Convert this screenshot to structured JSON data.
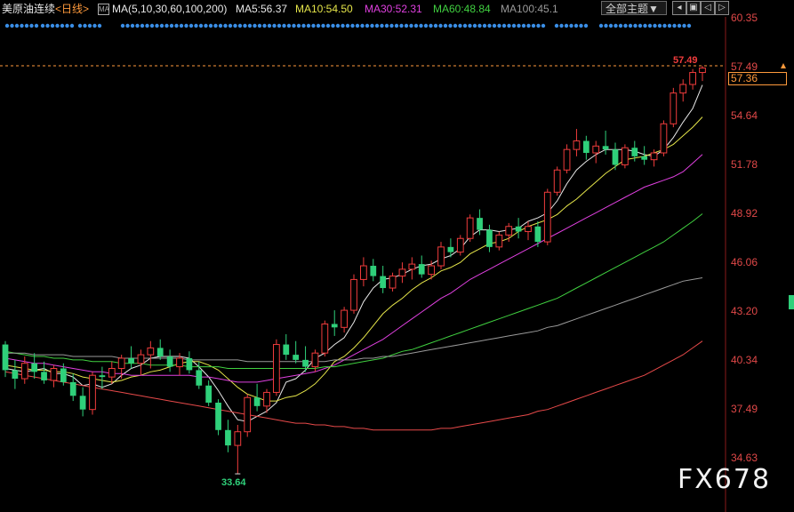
{
  "header": {
    "symbol": "美原油连续",
    "period_open": "<",
    "period": "日线",
    "period_close": ">",
    "ma_icon": "MA",
    "ma_params": "MA(5,10,30,60,100,200)",
    "ma5": "MA5:56.37",
    "ma10": "MA10:54.50",
    "ma30": "MA30:52.31",
    "ma60": "MA60:48.84",
    "ma100": "MA100:45.1",
    "theme_button": "全部主题▼",
    "colors": {
      "ma5": "#e8e8e8",
      "ma10": "#e6e64a",
      "ma30": "#e040e0",
      "ma60": "#40d040",
      "ma100": "#9a9a9a",
      "ma200": "#e84a4a"
    }
  },
  "toolbar_icons": [
    "left-arrow-icon",
    "expand-icon",
    "back-icon",
    "forward-icon"
  ],
  "price_axis": {
    "ticks": [
      "60.35",
      "57.49",
      "54.64",
      "51.78",
      "48.92",
      "46.06",
      "43.20",
      "40.34",
      "37.49",
      "34.63"
    ],
    "current_price": "57.36"
  },
  "annotations": {
    "high": "57.49",
    "low": "33.64"
  },
  "watermark": "FX678",
  "chart_data": {
    "type": "candlestick",
    "ylim": [
      33.0,
      60.35
    ],
    "colors": {
      "up": "#f03c3c",
      "down": "#2fd07a"
    },
    "ohlc": [
      [
        41.2,
        41.4,
        39.3,
        39.7
      ],
      [
        39.7,
        40.3,
        38.6,
        39.2
      ],
      [
        39.2,
        40.5,
        38.9,
        40.1
      ],
      [
        40.1,
        40.7,
        39.2,
        39.6
      ],
      [
        39.6,
        40.2,
        38.9,
        39.1
      ],
      [
        39.1,
        40.0,
        38.7,
        39.8
      ],
      [
        39.8,
        40.1,
        38.8,
        39.0
      ],
      [
        39.0,
        39.5,
        37.9,
        38.2
      ],
      [
        38.2,
        38.7,
        37.0,
        37.4
      ],
      [
        37.4,
        39.6,
        37.1,
        39.4
      ],
      [
        39.4,
        39.9,
        38.6,
        39.3
      ],
      [
        39.3,
        40.2,
        38.9,
        39.8
      ],
      [
        39.8,
        40.6,
        39.2,
        40.4
      ],
      [
        40.4,
        41.1,
        39.8,
        40.1
      ],
      [
        40.1,
        40.9,
        39.4,
        40.6
      ],
      [
        40.6,
        41.4,
        39.8,
        41.0
      ],
      [
        41.0,
        41.5,
        40.3,
        40.5
      ],
      [
        40.5,
        40.9,
        39.6,
        39.9
      ],
      [
        39.9,
        40.7,
        39.4,
        40.4
      ],
      [
        40.4,
        40.8,
        39.5,
        39.7
      ],
      [
        39.7,
        40.2,
        38.6,
        38.8
      ],
      [
        38.8,
        39.1,
        37.6,
        37.8
      ],
      [
        37.8,
        38.0,
        35.9,
        36.2
      ],
      [
        36.2,
        36.8,
        34.9,
        35.3
      ],
      [
        35.3,
        36.5,
        33.64,
        36.1
      ],
      [
        36.1,
        38.3,
        35.8,
        38.1
      ],
      [
        38.1,
        38.9,
        37.3,
        37.6
      ],
      [
        37.6,
        38.6,
        37.2,
        38.4
      ],
      [
        38.4,
        41.5,
        38.2,
        41.2
      ],
      [
        41.2,
        41.8,
        40.3,
        40.6
      ],
      [
        40.6,
        41.4,
        40.1,
        40.3
      ],
      [
        40.3,
        41.1,
        39.6,
        39.9
      ],
      [
        39.9,
        40.9,
        39.6,
        40.7
      ],
      [
        40.7,
        42.6,
        40.5,
        42.4
      ],
      [
        42.4,
        43.2,
        41.7,
        42.2
      ],
      [
        42.2,
        43.4,
        41.9,
        43.2
      ],
      [
        43.2,
        45.3,
        43.0,
        45.0
      ],
      [
        45.0,
        46.3,
        44.6,
        45.8
      ],
      [
        45.8,
        46.2,
        44.9,
        45.2
      ],
      [
        45.2,
        45.8,
        44.2,
        44.5
      ],
      [
        44.5,
        45.4,
        44.3,
        45.2
      ],
      [
        45.2,
        46.0,
        44.8,
        45.6
      ],
      [
        45.6,
        46.3,
        45.0,
        45.9
      ],
      [
        45.9,
        46.4,
        45.1,
        45.3
      ],
      [
        45.3,
        46.1,
        45.0,
        45.8
      ],
      [
        45.8,
        47.2,
        45.6,
        46.9
      ],
      [
        46.9,
        47.4,
        46.3,
        46.6
      ],
      [
        46.6,
        47.6,
        46.4,
        47.4
      ],
      [
        47.4,
        48.8,
        47.2,
        48.6
      ],
      [
        48.6,
        49.1,
        47.6,
        47.9
      ],
      [
        47.9,
        48.2,
        46.6,
        46.9
      ],
      [
        46.9,
        47.8,
        46.7,
        47.6
      ],
      [
        47.6,
        48.3,
        47.2,
        48.1
      ],
      [
        48.1,
        48.6,
        47.4,
        47.8
      ],
      [
        47.8,
        48.4,
        47.3,
        48.1
      ],
      [
        48.1,
        48.4,
        46.9,
        47.2
      ],
      [
        47.2,
        50.3,
        47.0,
        50.1
      ],
      [
        50.1,
        51.6,
        49.9,
        51.4
      ],
      [
        51.4,
        52.9,
        51.2,
        52.6
      ],
      [
        52.6,
        53.8,
        52.2,
        53.1
      ],
      [
        53.1,
        53.4,
        52.0,
        52.4
      ],
      [
        52.4,
        53.1,
        51.8,
        52.8
      ],
      [
        52.8,
        53.7,
        52.3,
        52.6
      ],
      [
        52.6,
        53.0,
        51.4,
        51.7
      ],
      [
        51.7,
        52.9,
        51.5,
        52.7
      ],
      [
        52.7,
        53.1,
        51.9,
        52.2
      ],
      [
        52.2,
        52.8,
        51.7,
        52.0
      ],
      [
        52.0,
        52.6,
        51.6,
        52.4
      ],
      [
        52.4,
        54.3,
        52.2,
        54.1
      ],
      [
        54.1,
        56.2,
        53.9,
        55.9
      ],
      [
        55.9,
        56.7,
        55.4,
        56.4
      ],
      [
        56.4,
        57.3,
        56.1,
        57.1
      ],
      [
        57.1,
        57.49,
        56.6,
        57.36
      ]
    ],
    "ma": {
      "MA5": [
        39.8,
        39.7,
        39.6,
        39.7,
        39.8,
        39.5,
        39.5,
        39.3,
        38.8,
        38.9,
        38.7,
        38.9,
        39.4,
        39.8,
        40.0,
        40.4,
        40.5,
        40.5,
        40.5,
        40.4,
        39.9,
        39.3,
        38.5,
        37.6,
        36.8,
        36.7,
        37.0,
        37.3,
        37.8,
        39.0,
        39.2,
        39.7,
        40.4,
        40.7,
        41.2,
        41.6,
        42.5,
        43.7,
        44.5,
        45.0,
        45.1,
        45.3,
        45.6,
        45.8,
        45.9,
        46.2,
        46.4,
        46.8,
        47.5,
        47.9,
        47.9,
        47.8,
        47.9,
        48.0,
        48.4,
        48.6,
        48.9,
        49.6,
        50.6,
        51.4,
        51.9,
        52.3,
        52.6,
        52.6,
        52.6,
        52.5,
        52.3,
        52.2,
        52.6,
        53.3,
        54.2,
        55.0,
        56.37
      ],
      "MA10": [
        40.0,
        39.9,
        39.8,
        39.7,
        39.7,
        39.6,
        39.6,
        39.5,
        39.3,
        39.2,
        39.1,
        39.0,
        39.1,
        39.3,
        39.4,
        39.6,
        39.7,
        39.9,
        40.1,
        40.2,
        40.2,
        40.0,
        39.7,
        39.2,
        38.7,
        38.3,
        38.1,
        37.9,
        37.9,
        38.1,
        38.2,
        38.5,
        38.9,
        39.5,
        40.2,
        40.5,
        41.0,
        41.6,
        42.3,
        43.0,
        43.5,
        43.9,
        44.4,
        44.8,
        45.1,
        45.5,
        45.7,
        46.0,
        46.5,
        46.8,
        47.1,
        47.2,
        47.4,
        47.8,
        48.1,
        48.3,
        48.5,
        48.8,
        49.3,
        49.7,
        50.2,
        50.7,
        51.2,
        51.6,
        52.0,
        52.1,
        52.2,
        52.4,
        52.6,
        52.9,
        53.4,
        53.9,
        54.5
      ],
      "MA30": [
        40.4,
        40.3,
        40.2,
        40.1,
        40.1,
        40.0,
        39.9,
        39.8,
        39.7,
        39.6,
        39.6,
        39.5,
        39.5,
        39.4,
        39.4,
        39.4,
        39.4,
        39.4,
        39.4,
        39.4,
        39.3,
        39.3,
        39.2,
        39.1,
        39.0,
        39.0,
        39.0,
        39.1,
        39.2,
        39.3,
        39.4,
        39.5,
        39.6,
        39.8,
        40.0,
        40.3,
        40.6,
        40.9,
        41.2,
        41.5,
        41.9,
        42.3,
        42.7,
        43.1,
        43.5,
        43.9,
        44.2,
        44.6,
        45.0,
        45.3,
        45.6,
        45.9,
        46.2,
        46.5,
        46.8,
        47.1,
        47.4,
        47.7,
        48.0,
        48.3,
        48.6,
        48.9,
        49.2,
        49.5,
        49.8,
        50.1,
        50.4,
        50.6,
        50.8,
        51.0,
        51.3,
        51.8,
        52.31
      ],
      "MA60": [
        40.8,
        40.7,
        40.6,
        40.5,
        40.5,
        40.4,
        40.4,
        40.3,
        40.3,
        40.2,
        40.2,
        40.2,
        40.1,
        40.1,
        40.1,
        40.0,
        40.0,
        40.0,
        40.0,
        39.9,
        39.9,
        39.9,
        39.9,
        39.8,
        39.8,
        39.8,
        39.8,
        39.8,
        39.8,
        39.8,
        39.8,
        39.8,
        39.8,
        39.9,
        39.9,
        40.0,
        40.1,
        40.2,
        40.3,
        40.4,
        40.6,
        40.8,
        40.9,
        41.1,
        41.3,
        41.5,
        41.7,
        41.9,
        42.1,
        42.3,
        42.5,
        42.7,
        42.9,
        43.1,
        43.3,
        43.5,
        43.7,
        43.9,
        44.2,
        44.5,
        44.8,
        45.1,
        45.4,
        45.7,
        46.0,
        46.3,
        46.6,
        46.9,
        47.2,
        47.6,
        48.0,
        48.4,
        48.84
      ],
      "MA100": [
        40.7,
        40.7,
        40.7,
        40.6,
        40.6,
        40.6,
        40.6,
        40.5,
        40.5,
        40.5,
        40.5,
        40.5,
        40.4,
        40.4,
        40.4,
        40.4,
        40.4,
        40.4,
        40.4,
        40.3,
        40.3,
        40.3,
        40.3,
        40.3,
        40.3,
        40.2,
        40.2,
        40.2,
        40.2,
        40.2,
        40.2,
        40.2,
        40.2,
        40.2,
        40.3,
        40.3,
        40.3,
        40.4,
        40.4,
        40.5,
        40.5,
        40.6,
        40.7,
        40.8,
        40.9,
        41.0,
        41.1,
        41.2,
        41.3,
        41.4,
        41.5,
        41.6,
        41.7,
        41.8,
        41.9,
        42.0,
        42.2,
        42.3,
        42.5,
        42.7,
        42.9,
        43.1,
        43.3,
        43.5,
        43.7,
        43.9,
        44.1,
        44.3,
        44.5,
        44.7,
        44.9,
        45.0,
        45.1
      ],
      "MA200": [
        39.6,
        39.5,
        39.4,
        39.3,
        39.2,
        39.1,
        39.0,
        38.9,
        38.8,
        38.7,
        38.6,
        38.5,
        38.4,
        38.3,
        38.2,
        38.1,
        38.0,
        37.9,
        37.8,
        37.7,
        37.6,
        37.5,
        37.4,
        37.3,
        37.2,
        37.1,
        37.0,
        36.9,
        36.8,
        36.7,
        36.6,
        36.6,
        36.5,
        36.5,
        36.4,
        36.4,
        36.3,
        36.3,
        36.2,
        36.2,
        36.2,
        36.2,
        36.2,
        36.2,
        36.2,
        36.3,
        36.3,
        36.4,
        36.5,
        36.6,
        36.7,
        36.8,
        36.9,
        37.0,
        37.1,
        37.3,
        37.4,
        37.6,
        37.8,
        38.0,
        38.2,
        38.4,
        38.6,
        38.8,
        39.0,
        39.2,
        39.4,
        39.7,
        40.0,
        40.3,
        40.6,
        41.0,
        41.4
      ]
    }
  }
}
